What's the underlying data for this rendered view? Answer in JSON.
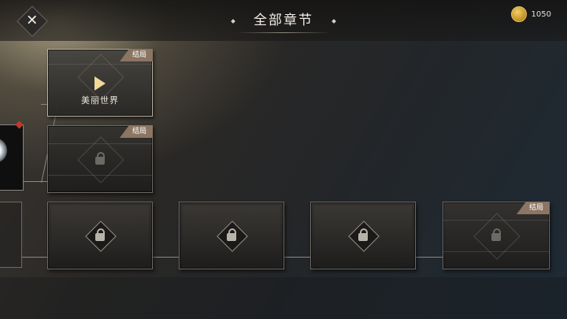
{
  "header": {
    "title": "全部章节",
    "currency_value": "1050",
    "close_icon": "close-icon",
    "currency_icon": "gold-coin-icon"
  },
  "chapters": [
    {
      "label": "美丽世界",
      "badge": "结局",
      "state": "unlocked",
      "icon": "play-icon"
    },
    {
      "label": "",
      "badge": "结局",
      "state": "locked",
      "icon": "lock-icon"
    },
    {
      "label": "",
      "badge": "",
      "state": "locked",
      "icon": "lock-icon"
    },
    {
      "label": "",
      "badge": "",
      "state": "locked",
      "icon": "lock-icon"
    },
    {
      "label": "",
      "badge": "",
      "state": "locked",
      "icon": "lock-icon"
    },
    {
      "label": "",
      "badge": "结局",
      "state": "locked",
      "icon": "lock-icon"
    }
  ],
  "colors": {
    "badge": "#8b7563",
    "accent_gold": "#f1d99a",
    "notification": "#c0392b"
  }
}
